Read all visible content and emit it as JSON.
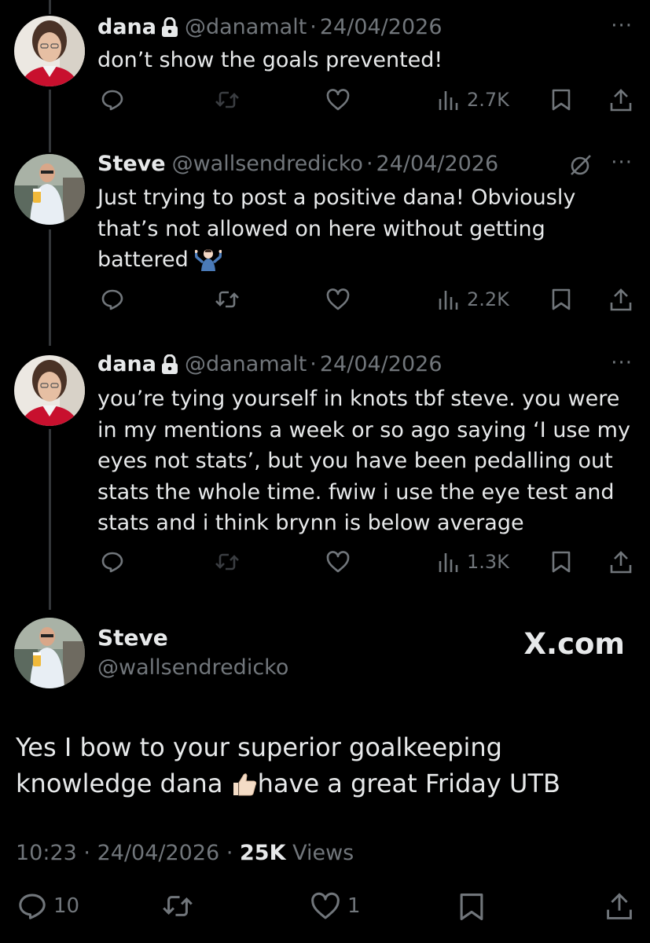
{
  "tweets": [
    {
      "name": "dana",
      "handle": "@danamalt",
      "sep": "·",
      "date": "24/04/2026",
      "locked": true,
      "text": "don’t show the goals prevented!",
      "views": "2.7K"
    },
    {
      "name": "Steve",
      "handle": "@wallsendredicko",
      "sep": "·",
      "date": "24/04/2026",
      "locked": false,
      "text": "Just trying to post a positive dana! Obviously that’s not allowed on here without getting battered",
      "views": "2.2K"
    },
    {
      "name": "dana",
      "handle": "@danamalt",
      "sep": "·",
      "date": "24/04/2026",
      "locked": true,
      "text": "you’re tying yourself in knots tbf steve. you were in my mentions a week or so ago saying ‘I use my eyes not stats’, but you have been pedalling out stats the whole time. fwiw i use the eye test and stats and i think brynn is below average",
      "views": "1.3K"
    }
  ],
  "main": {
    "name": "Steve",
    "handle": "@wallsendredicko",
    "watermark": "X.com",
    "text_part1": "Yes I bow to your superior goalkeeping knowledge dana ",
    "text_part2": "have a great Friday UTB",
    "time": "10:23",
    "sep": "·",
    "date": "24/04/2026",
    "views_count": "25K",
    "views_label": "Views",
    "replies": "10",
    "likes": "1"
  },
  "more_label": "···",
  "icons": [
    "reply-icon",
    "retweet-icon",
    "like-icon",
    "views-icon",
    "bookmark-icon",
    "share-icon",
    "lock-icon",
    "grok-icon",
    "shrug-emoji",
    "thumbs-up-emoji"
  ],
  "colors": {
    "background": "#000000",
    "text": "#e7e9ea",
    "muted": "#71767b",
    "thread_line": "#333639"
  }
}
